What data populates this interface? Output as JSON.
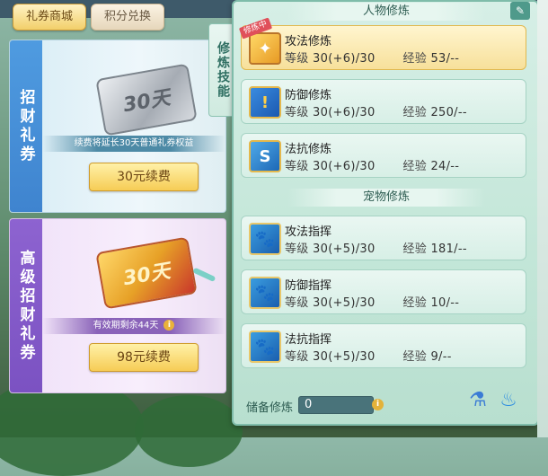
{
  "top_tabs": {
    "active": "礼券商城",
    "inactive": "积分兑换"
  },
  "cards": [
    {
      "label": "招财礼券",
      "ticket_text": "30天",
      "note": "续费将延长30天普通礼券权益",
      "button": "30元续费"
    },
    {
      "label": "高级招财礼券",
      "ticket_text": "30天",
      "note": "有效期剩余44天",
      "button": "98元续费"
    }
  ],
  "panel": {
    "side_tab": "修炼技能",
    "person_section_title": "人物修炼",
    "pet_section_title": "宠物修炼",
    "badge": "修炼中",
    "labels": {
      "level": "等级",
      "exp": "经验"
    },
    "person_skills": [
      {
        "name": "攻法修炼",
        "level": "30(+6)/30",
        "exp": "53/--",
        "icon": "attack-magic-icon",
        "selected": true
      },
      {
        "name": "防御修炼",
        "level": "30(+6)/30",
        "exp": "250/--",
        "icon": "defense-shield-icon",
        "selected": false
      },
      {
        "name": "法抗修炼",
        "level": "30(+6)/30",
        "exp": "24/--",
        "icon": "resist-shield-icon",
        "selected": false
      }
    ],
    "pet_skills": [
      {
        "name": "攻法指挥",
        "level": "30(+5)/30",
        "exp": "181/--",
        "icon": "pet-attack-icon"
      },
      {
        "name": "防御指挥",
        "level": "30(+5)/30",
        "exp": "10/--",
        "icon": "pet-defense-icon"
      },
      {
        "name": "法抗指挥",
        "level": "30(+5)/30",
        "exp": "9/--",
        "icon": "pet-resist-icon"
      }
    ],
    "reserve": {
      "label": "储备修炼",
      "value": "0"
    }
  }
}
